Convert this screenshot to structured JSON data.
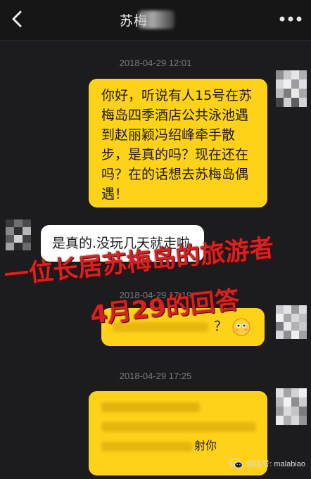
{
  "header": {
    "title": "苏梅"
  },
  "messages": [
    {
      "timestamp": "2018-04-29 12:01",
      "text": "你好，听说有人15号在苏梅岛四季酒店公共泳池遇到赵丽颖冯绍峰牵手散步，是真的吗？现在还在吗？在的话想去苏梅岛偶遇！"
    },
    {
      "text": "是真的.没玩几天就走啦"
    },
    {
      "timestamp": "2018-04-29 17:19",
      "text": "？"
    },
    {
      "timestamp": "2018-04-29 17:25",
      "text": "射你"
    }
  ],
  "overlay": {
    "line1": "一位长居苏梅岛的旅游者",
    "line2": "4月29的回答"
  },
  "watermark": {
    "text": "微信号: malabiao"
  },
  "colors": {
    "bubble_out": "#ffd21a",
    "bubble_in": "#ffffff",
    "background": "#1c1c1e",
    "overlay_red": "#d42322"
  }
}
